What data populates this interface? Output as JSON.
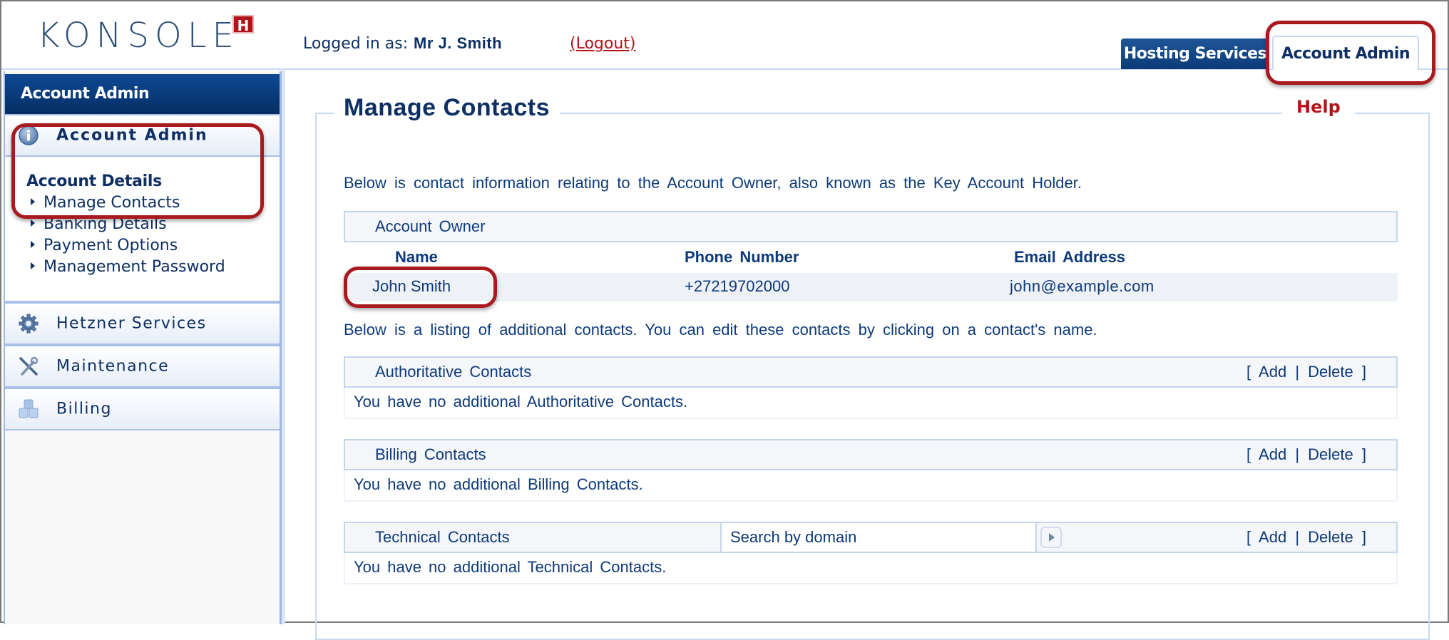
{
  "header": {
    "logo_text": "KONSOLE",
    "logo_badge": "H",
    "logged_in_label": "Logged in as:",
    "logged_in_user": "Mr J. Smith",
    "logout_label": "(Logout)",
    "tabs": [
      {
        "label": "Hosting Services",
        "active": false
      },
      {
        "label": "Account Admin",
        "active": true
      }
    ]
  },
  "sidebar": {
    "title": "Account Admin",
    "sections": [
      {
        "label": "Account Admin",
        "icon": "info-icon"
      },
      {
        "label": "Hetzner Services",
        "icon": "gear-icon"
      },
      {
        "label": "Maintenance",
        "icon": "tools-icon"
      },
      {
        "label": "Billing",
        "icon": "billing-icon"
      }
    ],
    "details_title": "Account Details",
    "links": [
      {
        "label": "Manage Contacts"
      },
      {
        "label": "Banking Details"
      },
      {
        "label": "Payment Options"
      },
      {
        "label": "Management Password"
      }
    ]
  },
  "main": {
    "title": "Manage Contacts",
    "help_label": "Help",
    "intro": "Below is contact information relating to the Account Owner, also known as the Key Account Holder.",
    "owner": {
      "section_title": "Account Owner",
      "columns": [
        "Name",
        "Phone Number",
        "Email Address"
      ],
      "row": {
        "name": "John Smith",
        "phone": "+27219702000",
        "email": "john@example.com"
      }
    },
    "listing_intro": "Below is a listing of additional contacts. You can edit these contacts by clicking on a contact's name.",
    "groups": [
      {
        "title": "Authoritative Contacts",
        "empty_text": "You have no additional Authoritative Contacts.",
        "add_label": "Add",
        "delete_label": "Delete"
      },
      {
        "title": "Billing Contacts",
        "empty_text": "You have no additional Billing Contacts.",
        "add_label": "Add",
        "delete_label": "Delete"
      },
      {
        "title": "Technical Contacts",
        "empty_text": "You have no additional Technical Contacts.",
        "add_label": "Add",
        "delete_label": "Delete",
        "search_placeholder": "Search by domain"
      }
    ],
    "bracket_open": "[",
    "bracket_sep": "|",
    "bracket_close": "]"
  },
  "colors": {
    "brand_navy": "#0d2f63",
    "accent_red": "#b4121a",
    "annotation_red": "#a91a1f",
    "border_blue": "#c4d5ec"
  }
}
